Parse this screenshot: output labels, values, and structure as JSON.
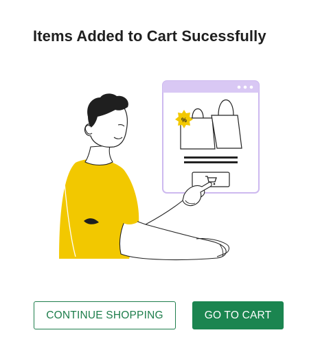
{
  "dialog": {
    "title": "Items Added to Cart Sucessfully",
    "illustration": {
      "subject": "person-tapping-add-to-cart",
      "badge_symbol": "%",
      "colors": {
        "shirt": "#f2c800",
        "browser_frame": "#cdb9ef",
        "browser_fill": "#ffffff",
        "badge": "#f2c800",
        "outline": "#222222"
      }
    },
    "buttons": {
      "continue_label": "CONTINUE SHOPPING",
      "go_to_cart_label": "GO TO CART"
    },
    "colors": {
      "accent": "#1b8550",
      "title_text": "#1f1f1f"
    }
  }
}
